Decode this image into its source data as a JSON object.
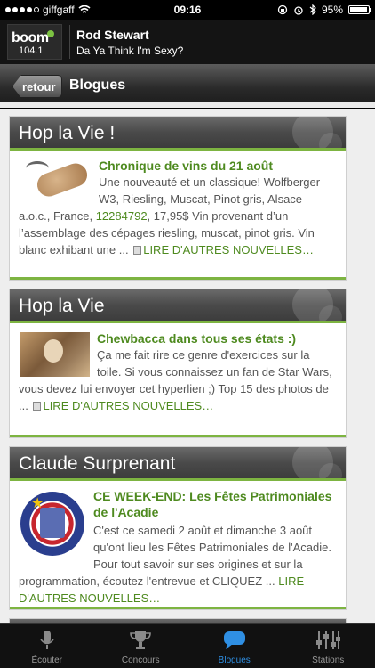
{
  "status_bar": {
    "carrier": "giffgaff",
    "time": "09:16",
    "battery": "95%",
    "battery_level": 0.95
  },
  "now_playing": {
    "station_name": "boom",
    "station_freq": "104.1",
    "artist": "Rod Stewart",
    "track": "Da Ya Think I'm Sexy?"
  },
  "nav": {
    "back_label": "retour",
    "title": "Blogues"
  },
  "cards": [
    {
      "header": "Hop la Vie !",
      "item_title": "Chronique de vins du 21 août",
      "text_before_link": "Une nouveauté et un classique! Wolfberger W3, Riesling, Muscat, Pinot gris, Alsace a.o.c., France, ",
      "inline_link": "12284792",
      "text_after_link": ", 17,95$   Vin provenant d’un l’assemblage des cépages riesling, muscat, pinot gris. Vin blanc exhibant une ...",
      "more_link": "LIRE D'AUTRES NOUVELLES…"
    },
    {
      "header": "Hop la Vie",
      "item_title": "Chewbacca dans tous ses états :)",
      "text": "Ça me fait rire ce genre d'exercices sur la toile. Si vous connaissez un fan de Star Wars, vous devez lui envoyer cet hyperlien ;) Top 15 des photos de ...",
      "more_link": "LIRE D'AUTRES NOUVELLES…"
    },
    {
      "header": "Claude Surprenant",
      "item_title": "CE WEEK-END: Les Fêtes Patrimoniales de l'Acadie",
      "text": "C'est ce samedi 2 août et dimanche 3 août qu'ont lieu les Fêtes Patrimoniales de l'Acadie. Pour tout savoir sur ses origines et sur la programmation, écoutez l'entrevue et CLIQUEZ ...",
      "more_link": "LIRE D'AUTRES NOUVELLES…"
    }
  ],
  "tabs": [
    {
      "label": "Écouter",
      "icon": "microphone-icon",
      "active": false
    },
    {
      "label": "Concours",
      "icon": "trophy-icon",
      "active": false
    },
    {
      "label": "Blogues",
      "icon": "chat-bubble-icon",
      "active": true
    },
    {
      "label": "Stations",
      "icon": "equalizer-icon",
      "active": false
    }
  ],
  "colors": {
    "accent_green": "#4e8a1f",
    "active_tab_blue": "#2f8fe3"
  }
}
